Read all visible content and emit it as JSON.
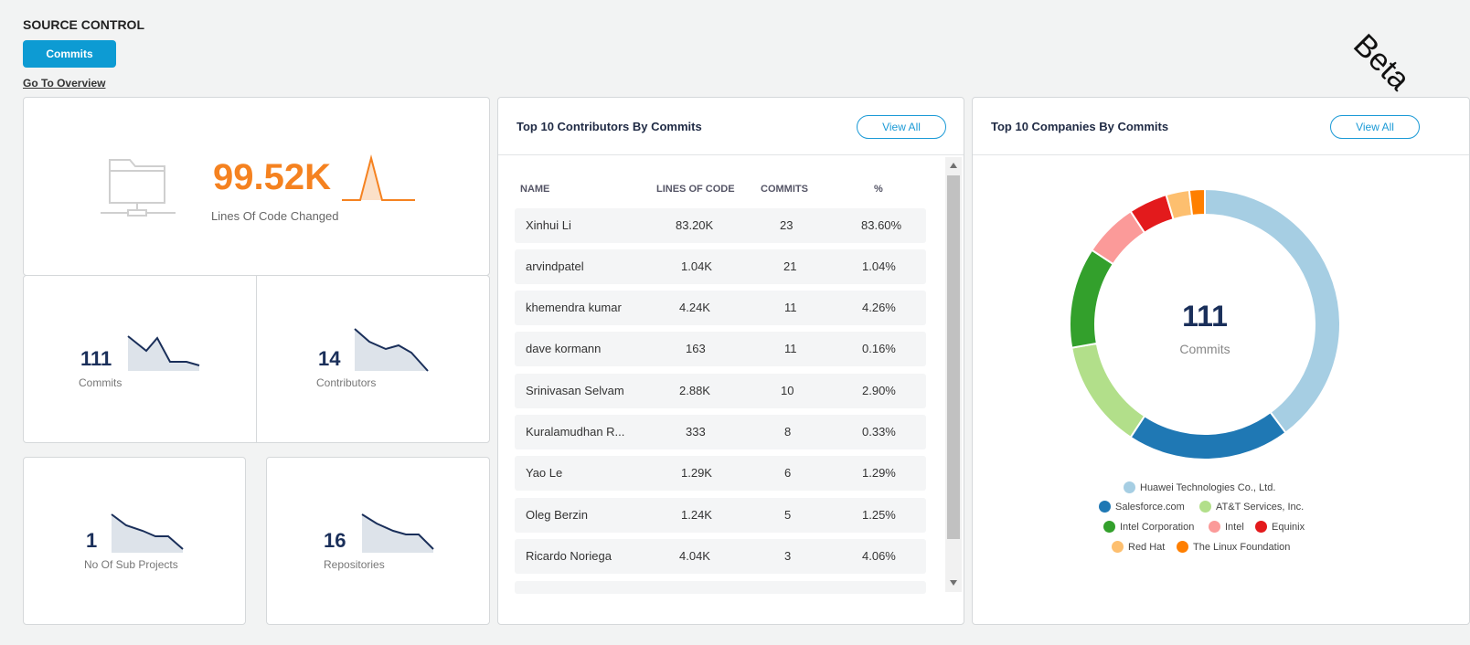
{
  "header": {
    "title": "SOURCE CONTROL",
    "commits_button": "Commits",
    "overview_link": "Go To Overview",
    "beta": "Beta"
  },
  "loc": {
    "value": "99.52K",
    "label": "Lines Of Code Changed"
  },
  "stats": {
    "commits": {
      "value": "111",
      "label": "Commits"
    },
    "contributors": {
      "value": "14",
      "label": "Contributors"
    },
    "subprojects": {
      "value": "1",
      "label": "No Of Sub Projects"
    },
    "repositories": {
      "value": "16",
      "label": "Repositories"
    }
  },
  "contributors": {
    "title": "Top 10 Contributors By Commits",
    "view_all": "View All",
    "columns": [
      "NAME",
      "LINES OF CODE",
      "COMMITS",
      "%"
    ],
    "rows": [
      {
        "name": "Xinhui Li",
        "loc": "83.20K",
        "commits": "23",
        "pct": "83.60%"
      },
      {
        "name": "arvindpatel",
        "loc": "1.04K",
        "commits": "21",
        "pct": "1.04%"
      },
      {
        "name": "khemendra kumar",
        "loc": "4.24K",
        "commits": "11",
        "pct": "4.26%"
      },
      {
        "name": "dave kormann",
        "loc": "163",
        "commits": "11",
        "pct": "0.16%"
      },
      {
        "name": "Srinivasan Selvam",
        "loc": "2.88K",
        "commits": "10",
        "pct": "2.90%"
      },
      {
        "name": "Kuralamudhan R...",
        "loc": "333",
        "commits": "8",
        "pct": "0.33%"
      },
      {
        "name": "Yao Le",
        "loc": "1.29K",
        "commits": "6",
        "pct": "1.29%"
      },
      {
        "name": "Oleg Berzin",
        "loc": "1.24K",
        "commits": "5",
        "pct": "1.25%"
      },
      {
        "name": "Ricardo Noriega",
        "loc": "4.04K",
        "commits": "3",
        "pct": "4.06%"
      }
    ]
  },
  "companies": {
    "title": "Top 10 Companies By Commits",
    "view_all": "View All",
    "center_value": "111",
    "center_label": "Commits"
  },
  "chart_data": {
    "type": "pie",
    "series": [
      {
        "name": "Huawei Technologies Co., Ltd.",
        "value": 43,
        "color": "#a6cee3"
      },
      {
        "name": "Salesforce.com",
        "value": 21,
        "color": "#1f78b4"
      },
      {
        "name": "AT&T Services, Inc.",
        "value": 14,
        "color": "#b2df8a"
      },
      {
        "name": "Intel Corporation",
        "value": 13,
        "color": "#33a02c"
      },
      {
        "name": "Intel",
        "value": 7,
        "color": "#fb9a99"
      },
      {
        "name": "Equinix",
        "value": 5,
        "color": "#e31a1c"
      },
      {
        "name": "Red Hat",
        "value": 3,
        "color": "#fdbf6f"
      },
      {
        "name": "The Linux Foundation",
        "value": 2,
        "color": "#ff7f00"
      }
    ]
  }
}
